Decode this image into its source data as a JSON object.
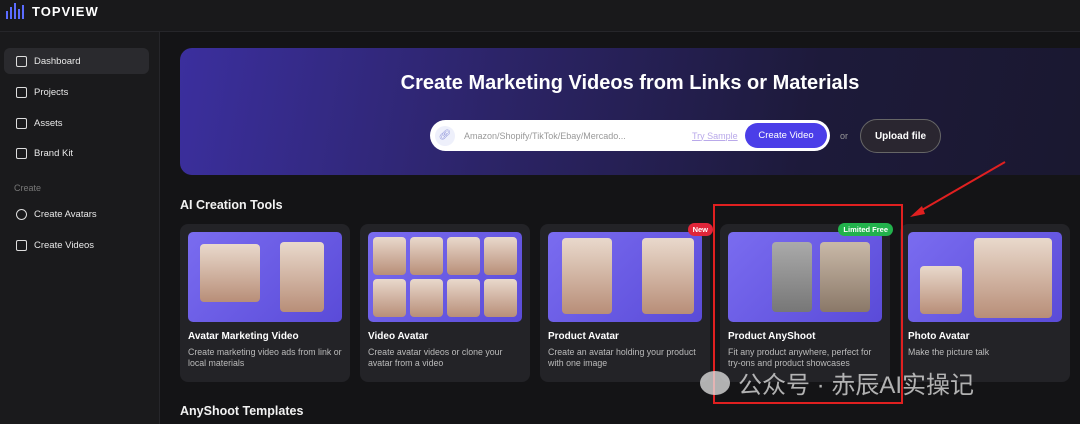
{
  "app": {
    "name": "TOPVIEW"
  },
  "sidebar": {
    "items": [
      {
        "label": "Dashboard",
        "icon": "grid-icon"
      },
      {
        "label": "Projects",
        "icon": "film-icon"
      },
      {
        "label": "Assets",
        "icon": "folder-icon"
      },
      {
        "label": "Brand Kit",
        "icon": "bookmark-star-icon"
      }
    ],
    "section": "Create",
    "create_items": [
      {
        "label": "Create Avatars",
        "icon": "avatar-plus-icon"
      },
      {
        "label": "Create Videos",
        "icon": "video-plus-icon"
      }
    ]
  },
  "banner": {
    "title": "Create Marketing Videos from Links or Materials",
    "placeholder": "Amazon/Shopify/TikTok/Ebay/Mercado...",
    "try_sample": "Try Sample",
    "create_video": "Create Video",
    "or": "or",
    "upload": "Upload file"
  },
  "tools": {
    "heading": "AI Creation Tools",
    "cards": [
      {
        "title": "Avatar Marketing Video",
        "desc": "Create marketing video ads from link or local materials"
      },
      {
        "title": "Video Avatar",
        "desc": "Create avatar videos or clone your avatar from a video"
      },
      {
        "title": "Product Avatar",
        "desc": "Create an avatar holding your product with one image",
        "badge": "New"
      },
      {
        "title": "Product AnyShoot",
        "desc": "Fit any product anywhere, perfect for try-ons and product showcases",
        "badge": "Limited Free"
      },
      {
        "title": "Photo Avatar",
        "desc": "Make the picture talk"
      }
    ]
  },
  "templates": {
    "heading": "AnyShoot Templates"
  },
  "watermark": "公众号 · 赤辰AI实操记",
  "colors": {
    "accent": "#4b3ee8",
    "new": "#e0263a",
    "limited": "#22b24c",
    "highlight": "#e02020"
  }
}
